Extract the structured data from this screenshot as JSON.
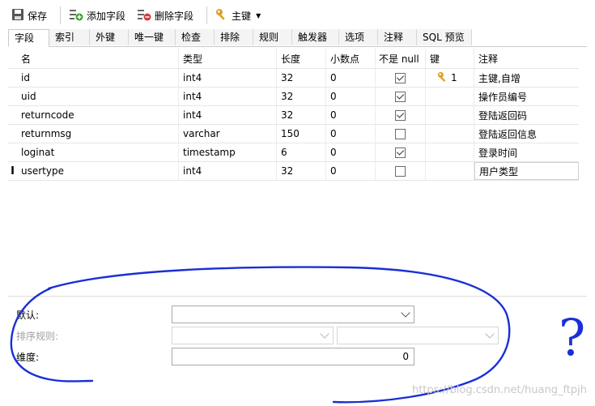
{
  "toolbar": {
    "save": "保存",
    "add_field": "添加字段",
    "delete_field": "删除字段",
    "primary_key": "主键"
  },
  "tabs": [
    "字段",
    "索引",
    "外键",
    "唯一键",
    "检查",
    "排除",
    "规则",
    "触发器",
    "选项",
    "注释",
    "SQL 预览"
  ],
  "columns": {
    "name": "名",
    "type": "类型",
    "length": "长度",
    "decimal": "小数点",
    "not_null": "不是 null",
    "key": "键",
    "comment": "注释"
  },
  "rows": [
    {
      "name": "id",
      "type": "int4",
      "length": "32",
      "decimal": "0",
      "not_null": true,
      "key": "1",
      "comment": "主键,自增"
    },
    {
      "name": "uid",
      "type": "int4",
      "length": "32",
      "decimal": "0",
      "not_null": true,
      "key": "",
      "comment": "操作员编号"
    },
    {
      "name": "returncode",
      "type": "int4",
      "length": "32",
      "decimal": "0",
      "not_null": true,
      "key": "",
      "comment": "登陆返回码"
    },
    {
      "name": "returnmsg",
      "type": "varchar",
      "length": "150",
      "decimal": "0",
      "not_null": false,
      "key": "",
      "comment": "登陆返回信息"
    },
    {
      "name": "loginat",
      "type": "timestamp",
      "length": "6",
      "decimal": "0",
      "not_null": true,
      "key": "",
      "comment": "登录时间"
    },
    {
      "name": "usertype",
      "type": "int4",
      "length": "32",
      "decimal": "0",
      "not_null": false,
      "key": "",
      "comment": "用户类型"
    }
  ],
  "row_cursor": "I",
  "props": {
    "default_label": "默认:",
    "collation_label": "排序规则:",
    "dimension_label": "维度:",
    "dimension_value": "0"
  },
  "annotation": {
    "question_mark": "?"
  },
  "watermark": "https://blog.csdn.net/huang_ftpjh",
  "colors": {
    "annotation": "#1a2fd6",
    "key_icon": "#e0a020"
  }
}
